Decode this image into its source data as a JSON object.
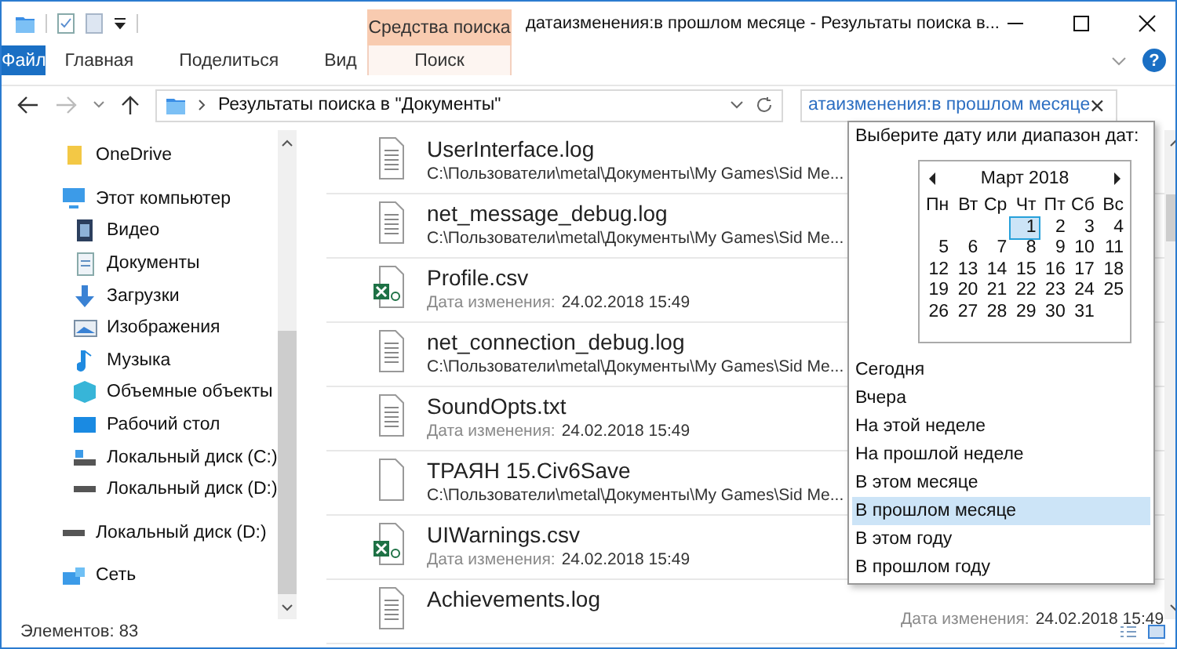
{
  "window": {
    "title": "датаизменения:в прошлом месяце - Результаты поиска в...",
    "contextual_group": "Средства поиска",
    "help": "?"
  },
  "ribbon_tabs": [
    {
      "label": "Файл",
      "kind": "file"
    },
    {
      "label": "Главная",
      "kind": "tab"
    },
    {
      "label": "Поделиться",
      "kind": "tab"
    },
    {
      "label": "Вид",
      "kind": "tab"
    },
    {
      "label": "Поиск",
      "kind": "contextual"
    }
  ],
  "address": {
    "path": "Результаты поиска в \"Документы\"",
    "forward_disabled": true
  },
  "search": {
    "value": "атаизменения:в прошлом месяце"
  },
  "sidebar": {
    "items": [
      {
        "label": "OneDrive"
      },
      {
        "label": "Этот компьютер",
        "children": [
          {
            "label": "Видео"
          },
          {
            "label": "Документы"
          },
          {
            "label": "Загрузки"
          },
          {
            "label": "Изображения"
          },
          {
            "label": "Музыка"
          },
          {
            "label": "Объемные объекты"
          },
          {
            "label": "Рабочий стол"
          },
          {
            "label": "Локальный диск (C:)"
          },
          {
            "label": "Локальный диск (D:)"
          }
        ]
      },
      {
        "label": "Локальный диск (D:)"
      },
      {
        "label": "Сеть"
      }
    ]
  },
  "files": [
    {
      "name": "UserInterface.log",
      "kind": "text",
      "detail": {
        "kind": "path",
        "text": "C:\\Пользователи\\metal\\Документы\\My Games\\Sid Me..."
      }
    },
    {
      "name": "net_message_debug.log",
      "kind": "text",
      "detail": {
        "kind": "path",
        "text": "C:\\Пользователи\\metal\\Документы\\My Games\\Sid Me..."
      }
    },
    {
      "name": "Profile.csv",
      "kind": "excel",
      "detail": {
        "kind": "date",
        "label": "Дата изменения:",
        "value": "24.02.2018 15:49"
      }
    },
    {
      "name": "net_connection_debug.log",
      "kind": "text",
      "detail": {
        "kind": "path",
        "text": "C:\\Пользователи\\metal\\Документы\\My Games\\Sid Me..."
      }
    },
    {
      "name": "SoundOpts.txt",
      "kind": "text",
      "detail": {
        "kind": "date",
        "label": "Дата изменения:",
        "value": "24.02.2018 15:49"
      }
    },
    {
      "name": "ТРАЯН 15.Civ6Save",
      "kind": "blank",
      "detail": {
        "kind": "path",
        "text": "C:\\Пользователи\\metal\\Документы\\My Games\\Sid Me..."
      }
    },
    {
      "name": "UIWarnings.csv",
      "kind": "excel",
      "detail": {
        "kind": "date",
        "label": "Дата изменения:",
        "value": "24.02.2018 15:49"
      }
    },
    {
      "name": "Achievements.log",
      "kind": "text",
      "side": {
        "label": "Дата изменения:",
        "value": "24.02.2018 15:49"
      }
    }
  ],
  "date_picker": {
    "prompt": "Выберите дату или диапазон дат:",
    "month": "Март 2018",
    "weekdays": [
      "Пн",
      "Вт",
      "Ср",
      "Чт",
      "Пт",
      "Сб",
      "Вс"
    ],
    "weeks": [
      [
        {
          "d": "1",
          "selected": true
        },
        {
          "d": "2",
          "selected": false
        },
        {
          "d": "3",
          "selected": false
        },
        {
          "d": "4",
          "selected": false
        }
      ],
      [
        {
          "d": "5",
          "selected": false
        },
        {
          "d": "6",
          "selected": false
        },
        {
          "d": "7",
          "selected": false
        },
        {
          "d": "8",
          "selected": false
        },
        {
          "d": "9",
          "selected": false
        },
        {
          "d": "10",
          "selected": false
        },
        {
          "d": "11",
          "selected": false
        }
      ],
      [
        {
          "d": "12",
          "selected": false
        },
        {
          "d": "13",
          "selected": false
        },
        {
          "d": "14",
          "selected": false
        },
        {
          "d": "15",
          "selected": false
        },
        {
          "d": "16",
          "selected": false
        },
        {
          "d": "17",
          "selected": false
        },
        {
          "d": "18",
          "selected": false
        }
      ],
      [
        {
          "d": "19",
          "selected": false
        },
        {
          "d": "20",
          "selected": false
        },
        {
          "d": "21",
          "selected": false
        },
        {
          "d": "22",
          "selected": false
        },
        {
          "d": "23",
          "selected": false
        },
        {
          "d": "24",
          "selected": false
        },
        {
          "d": "25",
          "selected": false
        }
      ],
      [
        {
          "d": "26",
          "selected": false
        },
        {
          "d": "27",
          "selected": false
        },
        {
          "d": "28",
          "selected": false
        },
        {
          "d": "29",
          "selected": false
        },
        {
          "d": "30",
          "selected": false
        },
        {
          "d": "31",
          "selected": false
        }
      ]
    ],
    "presets": [
      {
        "label": "Сегодня",
        "selected": false
      },
      {
        "label": "Вчера",
        "selected": false
      },
      {
        "label": "На этой неделе",
        "selected": false
      },
      {
        "label": "На прошлой неделе",
        "selected": false
      },
      {
        "label": "В этом месяце",
        "selected": false
      },
      {
        "label": "В прошлом месяце",
        "selected": true
      },
      {
        "label": "В этом году",
        "selected": false
      },
      {
        "label": "В прошлом году",
        "selected": false
      }
    ]
  },
  "status_bar": {
    "text": "Элементов: 83"
  }
}
